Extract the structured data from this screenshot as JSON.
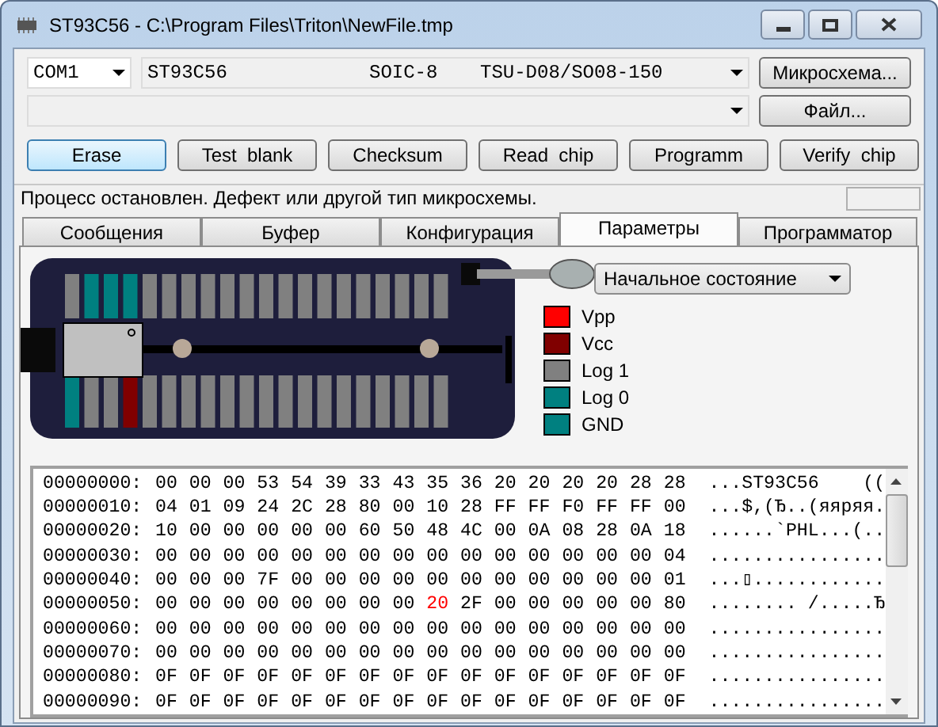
{
  "window": {
    "title": "ST93C56 - C:\\Program Files\\Triton\\NewFile.tmp"
  },
  "port_select": {
    "value": "COM1"
  },
  "chip_select": {
    "name": "ST93C56",
    "package": "SOIC-8",
    "adapter": "TSU-D08/SO08-150"
  },
  "chip_button": {
    "label": "Микросхема..."
  },
  "file_button": {
    "label": "Файл..."
  },
  "action_buttons": [
    {
      "label": "Erase",
      "focused": true
    },
    {
      "label": "Test  blank",
      "focused": false
    },
    {
      "label": "Checksum",
      "focused": false
    },
    {
      "label": "Read  chip",
      "focused": false
    },
    {
      "label": "Programm",
      "focused": false
    },
    {
      "label": "Verify  chip",
      "focused": false
    }
  ],
  "status": {
    "text": "Процесс остановлен.  Дефект или другой тип микросхемы."
  },
  "tabs": [
    {
      "label": "Сообщения",
      "selected": false
    },
    {
      "label": "Буфер",
      "selected": false
    },
    {
      "label": "Конфигурация",
      "selected": false
    },
    {
      "label": "Параметры",
      "selected": true
    },
    {
      "label": "Программатор",
      "selected": false
    }
  ],
  "mode_select": {
    "value": "Начальное состояние"
  },
  "legend": [
    {
      "label": "Vpp",
      "color": "#ff0000"
    },
    {
      "label": "Vcc",
      "color": "#800000"
    },
    {
      "label": "Log 1",
      "color": "#808080"
    },
    {
      "label": "Log 0",
      "color": "#008080"
    },
    {
      "label": "GND",
      "color": "#008080"
    }
  ],
  "socket": {
    "top_pins": [
      {
        "color": "#808080"
      },
      {
        "color": "#008080"
      },
      {
        "color": "#008080"
      },
      {
        "color": "#008080"
      },
      {
        "color": "#808080"
      },
      {
        "color": "#808080"
      },
      {
        "color": "#808080"
      },
      {
        "color": "#808080"
      },
      {
        "color": "#808080"
      },
      {
        "color": "#808080"
      },
      {
        "color": "#808080"
      },
      {
        "color": "#808080"
      },
      {
        "color": "#808080"
      },
      {
        "color": "#808080"
      },
      {
        "color": "#808080"
      },
      {
        "color": "#808080"
      },
      {
        "color": "#808080"
      },
      {
        "color": "#808080"
      },
      {
        "color": "#808080"
      },
      {
        "color": "#808080"
      }
    ],
    "bottom_pins": [
      {
        "color": "#008080"
      },
      {
        "color": "#808080"
      },
      {
        "color": "#808080"
      },
      {
        "color": "#800000"
      },
      {
        "color": "#808080"
      },
      {
        "color": "#808080"
      },
      {
        "color": "#808080"
      },
      {
        "color": "#808080"
      },
      {
        "color": "#808080"
      },
      {
        "color": "#808080"
      },
      {
        "color": "#808080"
      },
      {
        "color": "#808080"
      },
      {
        "color": "#808080"
      },
      {
        "color": "#808080"
      },
      {
        "color": "#808080"
      },
      {
        "color": "#808080"
      },
      {
        "color": "#808080"
      },
      {
        "color": "#808080"
      },
      {
        "color": "#808080"
      },
      {
        "color": "#808080"
      }
    ]
  },
  "hex_rows": [
    {
      "address": "00000000:",
      "bytes": [
        {
          "v": "00",
          "changed": false
        },
        {
          "v": "00",
          "changed": false
        },
        {
          "v": "00",
          "changed": false
        },
        {
          "v": "53",
          "changed": false
        },
        {
          "v": "54",
          "changed": false
        },
        {
          "v": "39",
          "changed": false
        },
        {
          "v": "33",
          "changed": false
        },
        {
          "v": "43",
          "changed": false
        },
        {
          "v": "35",
          "changed": false
        },
        {
          "v": "36",
          "changed": false
        },
        {
          "v": "20",
          "changed": false
        },
        {
          "v": "20",
          "changed": false
        },
        {
          "v": "20",
          "changed": false
        },
        {
          "v": "20",
          "changed": false
        },
        {
          "v": "28",
          "changed": false
        },
        {
          "v": "28",
          "changed": false
        }
      ],
      "ascii": "...ST93C56    (("
    },
    {
      "address": "00000010:",
      "bytes": [
        {
          "v": "04",
          "changed": false
        },
        {
          "v": "01",
          "changed": false
        },
        {
          "v": "09",
          "changed": false
        },
        {
          "v": "24",
          "changed": false
        },
        {
          "v": "2C",
          "changed": false
        },
        {
          "v": "28",
          "changed": false
        },
        {
          "v": "80",
          "changed": false
        },
        {
          "v": "00",
          "changed": false
        },
        {
          "v": "10",
          "changed": false
        },
        {
          "v": "28",
          "changed": false
        },
        {
          "v": "FF",
          "changed": false
        },
        {
          "v": "FF",
          "changed": false
        },
        {
          "v": "F0",
          "changed": false
        },
        {
          "v": "FF",
          "changed": false
        },
        {
          "v": "FF",
          "changed": false
        },
        {
          "v": "00",
          "changed": false
        }
      ],
      "ascii": "...$,(Ђ..(яяряя."
    },
    {
      "address": "00000020:",
      "bytes": [
        {
          "v": "10",
          "changed": false
        },
        {
          "v": "00",
          "changed": false
        },
        {
          "v": "00",
          "changed": false
        },
        {
          "v": "00",
          "changed": false
        },
        {
          "v": "00",
          "changed": false
        },
        {
          "v": "00",
          "changed": false
        },
        {
          "v": "60",
          "changed": false
        },
        {
          "v": "50",
          "changed": false
        },
        {
          "v": "48",
          "changed": false
        },
        {
          "v": "4C",
          "changed": false
        },
        {
          "v": "00",
          "changed": false
        },
        {
          "v": "0A",
          "changed": false
        },
        {
          "v": "08",
          "changed": false
        },
        {
          "v": "28",
          "changed": false
        },
        {
          "v": "0A",
          "changed": false
        },
        {
          "v": "18",
          "changed": false
        }
      ],
      "ascii": "......`PHL...(.."
    },
    {
      "address": "00000030:",
      "bytes": [
        {
          "v": "00",
          "changed": false
        },
        {
          "v": "00",
          "changed": false
        },
        {
          "v": "00",
          "changed": false
        },
        {
          "v": "00",
          "changed": false
        },
        {
          "v": "00",
          "changed": false
        },
        {
          "v": "00",
          "changed": false
        },
        {
          "v": "00",
          "changed": false
        },
        {
          "v": "00",
          "changed": false
        },
        {
          "v": "00",
          "changed": false
        },
        {
          "v": "00",
          "changed": false
        },
        {
          "v": "00",
          "changed": false
        },
        {
          "v": "00",
          "changed": false
        },
        {
          "v": "00",
          "changed": false
        },
        {
          "v": "00",
          "changed": false
        },
        {
          "v": "00",
          "changed": false
        },
        {
          "v": "04",
          "changed": false
        }
      ],
      "ascii": "................"
    },
    {
      "address": "00000040:",
      "bytes": [
        {
          "v": "00",
          "changed": false
        },
        {
          "v": "00",
          "changed": false
        },
        {
          "v": "00",
          "changed": false
        },
        {
          "v": "7F",
          "changed": false
        },
        {
          "v": "00",
          "changed": false
        },
        {
          "v": "00",
          "changed": false
        },
        {
          "v": "00",
          "changed": false
        },
        {
          "v": "00",
          "changed": false
        },
        {
          "v": "00",
          "changed": false
        },
        {
          "v": "00",
          "changed": false
        },
        {
          "v": "00",
          "changed": false
        },
        {
          "v": "00",
          "changed": false
        },
        {
          "v": "00",
          "changed": false
        },
        {
          "v": "00",
          "changed": false
        },
        {
          "v": "00",
          "changed": false
        },
        {
          "v": "01",
          "changed": false
        }
      ],
      "ascii": "...▯............"
    },
    {
      "address": "00000050:",
      "bytes": [
        {
          "v": "00",
          "changed": false
        },
        {
          "v": "00",
          "changed": false
        },
        {
          "v": "00",
          "changed": false
        },
        {
          "v": "00",
          "changed": false
        },
        {
          "v": "00",
          "changed": false
        },
        {
          "v": "00",
          "changed": false
        },
        {
          "v": "00",
          "changed": false
        },
        {
          "v": "00",
          "changed": false
        },
        {
          "v": "20",
          "changed": true
        },
        {
          "v": "2F",
          "changed": false
        },
        {
          "v": "00",
          "changed": false
        },
        {
          "v": "00",
          "changed": false
        },
        {
          "v": "00",
          "changed": false
        },
        {
          "v": "00",
          "changed": false
        },
        {
          "v": "00",
          "changed": false
        },
        {
          "v": "80",
          "changed": false
        }
      ],
      "ascii": "........ /.....Ђ"
    },
    {
      "address": "00000060:",
      "bytes": [
        {
          "v": "00",
          "changed": false
        },
        {
          "v": "00",
          "changed": false
        },
        {
          "v": "00",
          "changed": false
        },
        {
          "v": "00",
          "changed": false
        },
        {
          "v": "00",
          "changed": false
        },
        {
          "v": "00",
          "changed": false
        },
        {
          "v": "00",
          "changed": false
        },
        {
          "v": "00",
          "changed": false
        },
        {
          "v": "00",
          "changed": false
        },
        {
          "v": "00",
          "changed": false
        },
        {
          "v": "00",
          "changed": false
        },
        {
          "v": "00",
          "changed": false
        },
        {
          "v": "00",
          "changed": false
        },
        {
          "v": "00",
          "changed": false
        },
        {
          "v": "00",
          "changed": false
        },
        {
          "v": "00",
          "changed": false
        }
      ],
      "ascii": "................"
    },
    {
      "address": "00000070:",
      "bytes": [
        {
          "v": "00",
          "changed": false
        },
        {
          "v": "00",
          "changed": false
        },
        {
          "v": "00",
          "changed": false
        },
        {
          "v": "00",
          "changed": false
        },
        {
          "v": "00",
          "changed": false
        },
        {
          "v": "00",
          "changed": false
        },
        {
          "v": "00",
          "changed": false
        },
        {
          "v": "00",
          "changed": false
        },
        {
          "v": "00",
          "changed": false
        },
        {
          "v": "00",
          "changed": false
        },
        {
          "v": "00",
          "changed": false
        },
        {
          "v": "00",
          "changed": false
        },
        {
          "v": "00",
          "changed": false
        },
        {
          "v": "00",
          "changed": false
        },
        {
          "v": "00",
          "changed": false
        },
        {
          "v": "00",
          "changed": false
        }
      ],
      "ascii": "................"
    },
    {
      "address": "00000080:",
      "bytes": [
        {
          "v": "0F",
          "changed": false
        },
        {
          "v": "0F",
          "changed": false
        },
        {
          "v": "0F",
          "changed": false
        },
        {
          "v": "0F",
          "changed": false
        },
        {
          "v": "0F",
          "changed": false
        },
        {
          "v": "0F",
          "changed": false
        },
        {
          "v": "0F",
          "changed": false
        },
        {
          "v": "0F",
          "changed": false
        },
        {
          "v": "0F",
          "changed": false
        },
        {
          "v": "0F",
          "changed": false
        },
        {
          "v": "0F",
          "changed": false
        },
        {
          "v": "0F",
          "changed": false
        },
        {
          "v": "0F",
          "changed": false
        },
        {
          "v": "0F",
          "changed": false
        },
        {
          "v": "0F",
          "changed": false
        },
        {
          "v": "0F",
          "changed": false
        }
      ],
      "ascii": "................"
    },
    {
      "address": "00000090:",
      "bytes": [
        {
          "v": "0F",
          "changed": false
        },
        {
          "v": "0F",
          "changed": false
        },
        {
          "v": "0F",
          "changed": false
        },
        {
          "v": "0F",
          "changed": false
        },
        {
          "v": "0F",
          "changed": false
        },
        {
          "v": "0F",
          "changed": false
        },
        {
          "v": "0F",
          "changed": false
        },
        {
          "v": "0F",
          "changed": false
        },
        {
          "v": "0F",
          "changed": false
        },
        {
          "v": "0F",
          "changed": false
        },
        {
          "v": "0F",
          "changed": false
        },
        {
          "v": "0F",
          "changed": false
        },
        {
          "v": "0F",
          "changed": false
        },
        {
          "v": "0F",
          "changed": false
        },
        {
          "v": "0F",
          "changed": false
        },
        {
          "v": "0F",
          "changed": false
        }
      ],
      "ascii": "................"
    }
  ]
}
